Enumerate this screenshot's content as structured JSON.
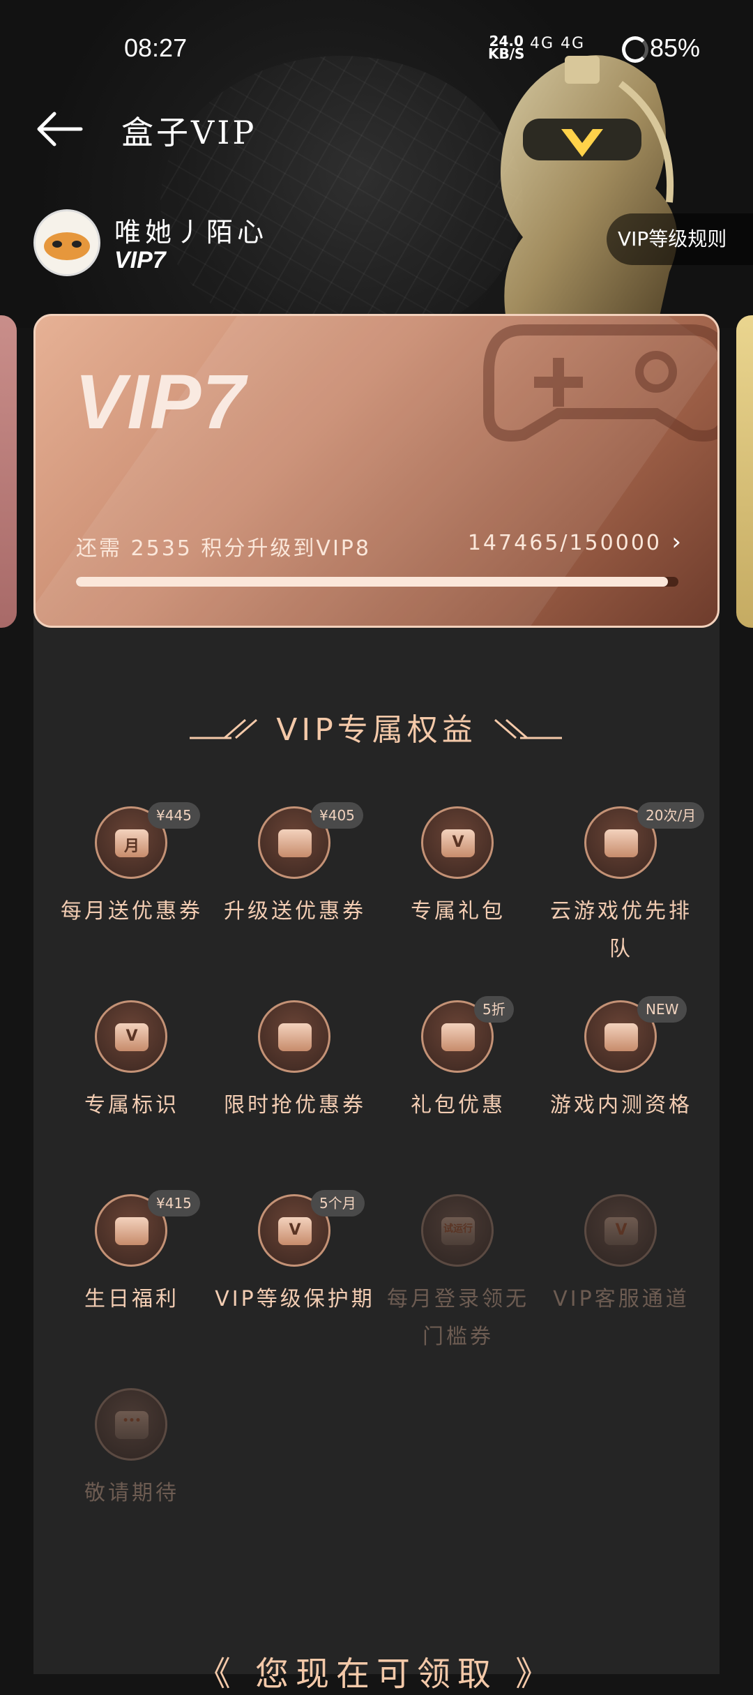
{
  "status": {
    "time": "08:27",
    "speed_value": "24.0",
    "speed_unit": "KB/S",
    "signal": "4G 4G",
    "battery": "85%"
  },
  "header": {
    "title": "盒子VIP"
  },
  "profile": {
    "username": "唯她丿陌心",
    "level": "VIP7",
    "rule_button": "VIP等级规则"
  },
  "vip_card": {
    "level": "VIP7",
    "upgrade_text": "还需 2535 积分升级到VIP8",
    "points": "147465/150000",
    "progress": 0.9831
  },
  "section": {
    "title": "VIP专属权益"
  },
  "benefits": [
    {
      "label": "每月送优惠券",
      "badge": "¥445",
      "glyph": "月",
      "dim": false
    },
    {
      "label": "升级送优惠券",
      "badge": "¥405",
      "glyph": "",
      "dim": false
    },
    {
      "label": "专属礼包",
      "badge": "",
      "glyph": "V",
      "dim": false
    },
    {
      "label": "云游戏优先排队",
      "badge": "20次/月",
      "glyph": "",
      "dim": false
    },
    {
      "label": "专属标识",
      "badge": "",
      "glyph": "V",
      "dim": false
    },
    {
      "label": "限时抢优惠券",
      "badge": "",
      "glyph": "",
      "dim": false
    },
    {
      "label": "礼包优惠",
      "badge": "5折",
      "glyph": "",
      "dim": false
    },
    {
      "label": "游戏内测资格",
      "badge": "NEW",
      "glyph": "",
      "dim": false
    },
    {
      "label": "生日福利",
      "badge": "¥415",
      "glyph": "",
      "dim": false
    },
    {
      "label": "VIP等级保护期",
      "badge": "5个月",
      "glyph": "V",
      "dim": false
    },
    {
      "label": "每月登录领无门槛券",
      "badge": "",
      "glyph": "试运行",
      "dim": true
    },
    {
      "label": "VIP客服通道",
      "badge": "",
      "glyph": "V",
      "dim": true
    },
    {
      "label": "敬请期待",
      "badge": "",
      "glyph": "•••",
      "dim": true
    }
  ],
  "bottom": {
    "title": "《 您现在可领取 》"
  },
  "colors": {
    "accent": "#f4c9a9",
    "card_start": "#e6b195",
    "card_end": "#6e3c2c",
    "panel": "#252525"
  }
}
